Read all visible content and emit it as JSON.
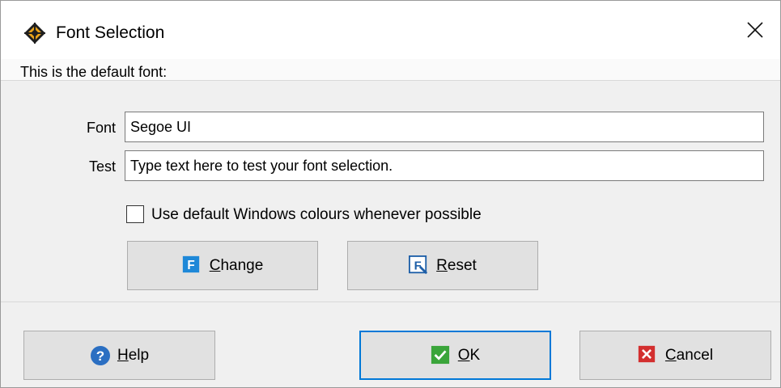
{
  "window": {
    "title": "Font Selection",
    "app_icon": "compass-diamond-icon",
    "close_icon": "close-icon"
  },
  "main": {
    "header_text": "This is the default font:",
    "font_label": "Font",
    "font_value": "Segoe UI",
    "test_label": "Test",
    "test_value": "Type text here to test your font selection.",
    "checkbox_label": "Use default Windows colours whenever possible",
    "checkbox_checked": false,
    "change_button": {
      "pre": "",
      "accel": "C",
      "post": "hange",
      "icon": "font-f-icon"
    },
    "reset_button": {
      "pre": "",
      "accel": "R",
      "post": "eset",
      "icon": "font-reset-icon"
    }
  },
  "footer": {
    "help_button": {
      "pre": "",
      "accel": "H",
      "post": "elp",
      "icon": "help-icon"
    },
    "ok_button": {
      "pre": "",
      "accel": "O",
      "post": "K",
      "icon": "checkmark-icon"
    },
    "cancel_button": {
      "pre": "",
      "accel": "C",
      "post": "ancel",
      "icon": "cancel-x-icon"
    }
  },
  "colors": {
    "accent": "#0078d7",
    "ok_green": "#3aa53a",
    "cancel_red": "#d32f2f",
    "help_blue": "#2b6fc2"
  }
}
